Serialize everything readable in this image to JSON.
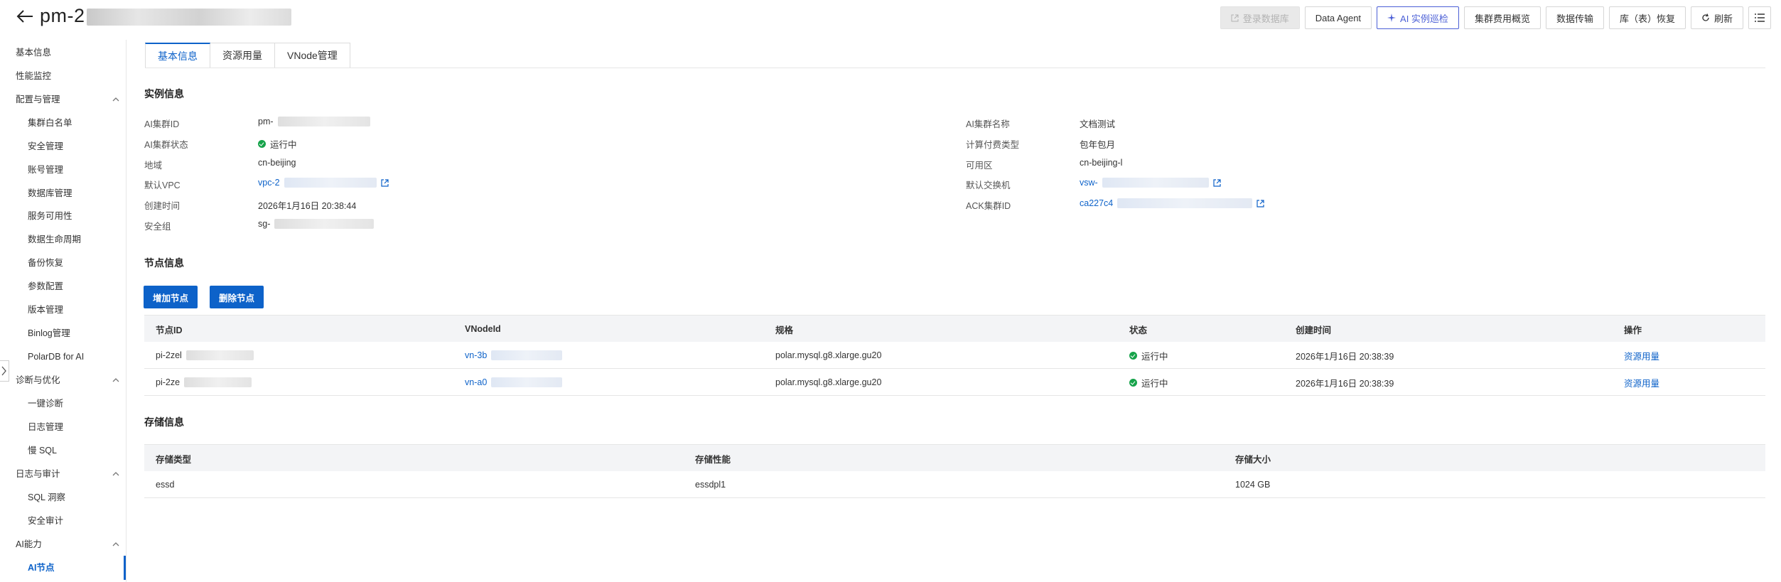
{
  "header": {
    "title": "pm-2",
    "toolbar": {
      "login_db": "登录数据库",
      "data_agent": "Data Agent",
      "ai_inspect": "AI 实例巡检",
      "cluster_cost": "集群费用概览",
      "data_transfer": "数据传输",
      "db_restore": "库（表）恢复",
      "refresh": "刷新"
    }
  },
  "sidebar": {
    "items": [
      {
        "label": "基本信息"
      },
      {
        "label": "性能监控"
      },
      {
        "label": "配置与管理"
      },
      {
        "label": "集群白名单"
      },
      {
        "label": "安全管理"
      },
      {
        "label": "账号管理"
      },
      {
        "label": "数据库管理"
      },
      {
        "label": "服务可用性"
      },
      {
        "label": "数据生命周期"
      },
      {
        "label": "备份恢复"
      },
      {
        "label": "参数配置"
      },
      {
        "label": "版本管理"
      },
      {
        "label": "Binlog管理"
      },
      {
        "label": "PolarDB for AI"
      },
      {
        "label": "诊断与优化"
      },
      {
        "label": "一键诊断"
      },
      {
        "label": "日志管理"
      },
      {
        "label": "慢 SQL"
      },
      {
        "label": "日志与审计"
      },
      {
        "label": "SQL 洞察"
      },
      {
        "label": "安全审计"
      },
      {
        "label": "AI能力"
      },
      {
        "label": "AI节点"
      }
    ]
  },
  "tabs": [
    "基本信息",
    "资源用量",
    "VNode管理"
  ],
  "instance": {
    "title": "实例信息",
    "left": [
      {
        "label": "AI集群ID",
        "value": "pm-"
      },
      {
        "label": "AI集群状态",
        "value": "运行中"
      },
      {
        "label": "地域",
        "value": "cn-beijing"
      },
      {
        "label": "默认VPC",
        "value": "vpc-2"
      },
      {
        "label": "创建时间",
        "value": "2026年1月16日 20:38:44"
      },
      {
        "label": "安全组",
        "value": "sg-"
      }
    ],
    "right": [
      {
        "label": "AI集群名称",
        "value": "文档测试"
      },
      {
        "label": "计算付费类型",
        "value": "包年包月"
      },
      {
        "label": "可用区",
        "value": "cn-beijing-l"
      },
      {
        "label": "默认交换机",
        "value": "vsw-"
      },
      {
        "label": "ACK集群ID",
        "value": "ca227c4"
      }
    ]
  },
  "nodes": {
    "title": "节点信息",
    "add_button": "增加节点",
    "delete_button": "删除节点",
    "columns": [
      "节点ID",
      "VNodeId",
      "规格",
      "状态",
      "创建时间",
      "操作"
    ],
    "rows": [
      {
        "id": "pi-2zel",
        "vnode": "vn-3b",
        "spec": "polar.mysql.g8.xlarge.gu20",
        "status": "运行中",
        "created": "2026年1月16日 20:38:39",
        "action": "资源用量"
      },
      {
        "id": "pi-2ze",
        "vnode": "vn-a0",
        "spec": "polar.mysql.g8.xlarge.gu20",
        "status": "运行中",
        "created": "2026年1月16日 20:38:39",
        "action": "资源用量"
      }
    ]
  },
  "storage": {
    "title": "存储信息",
    "columns": [
      "存储类型",
      "存储性能",
      "存储大小"
    ],
    "rows": [
      {
        "type": "essd",
        "perf": "essdpl1",
        "size": "1024 GB"
      }
    ]
  },
  "colors": {
    "accent": "#0d62c9",
    "success": "#16a34a",
    "ai_button": "#4b5fd6"
  }
}
